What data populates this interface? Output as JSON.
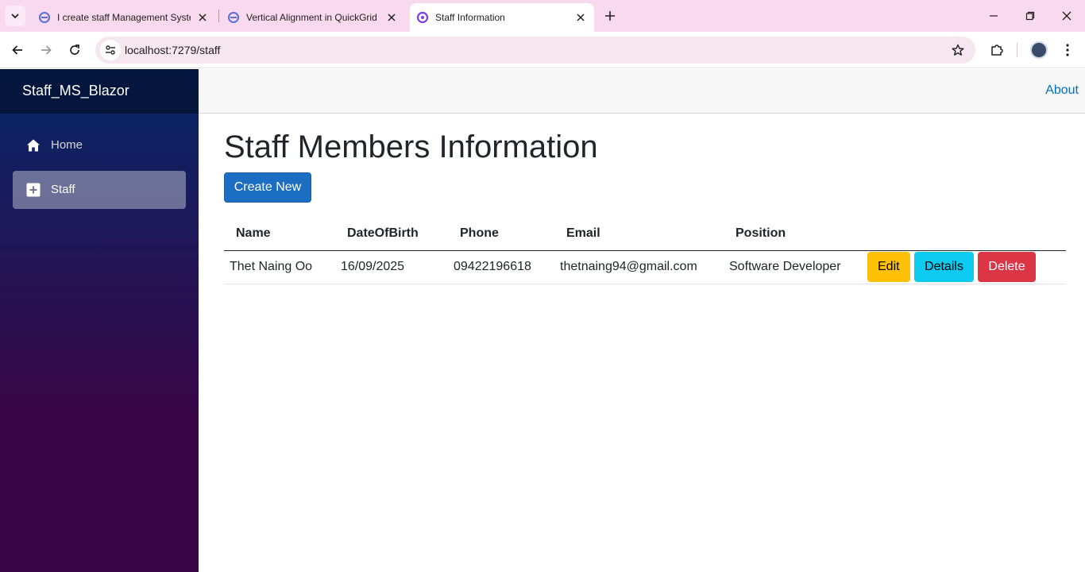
{
  "browser": {
    "tabs": [
      {
        "title": "I create staff Management Syste",
        "active": false
      },
      {
        "title": "Vertical Alignment in QuickGrid",
        "active": false
      },
      {
        "title": "Staff Information",
        "active": true
      }
    ],
    "url": "localhost:7279/staff"
  },
  "app": {
    "brand": "Staff_MS_Blazor",
    "nav": [
      {
        "label": "Home",
        "icon": "home-icon",
        "active": false
      },
      {
        "label": "Staff",
        "icon": "plus-square-icon",
        "active": true
      }
    ],
    "top_link": "About"
  },
  "page": {
    "title": "Staff Members Information",
    "create_label": "Create New",
    "columns": [
      "Name",
      "DateOfBirth",
      "Phone",
      "Email",
      "Position"
    ],
    "rows": [
      {
        "name": "Thet Naing Oo",
        "dob": "16/09/2025",
        "phone": "09422196618",
        "email": "thetnaing94@gmail.com",
        "position": "Software Developer",
        "actions": {
          "edit": "Edit",
          "details": "Details",
          "delete": "Delete"
        }
      }
    ]
  },
  "colors": {
    "primary": "#1b6ec2",
    "warning": "#ffc107",
    "info": "#0dcaf0",
    "danger": "#dc3545",
    "link": "#0071c1"
  }
}
